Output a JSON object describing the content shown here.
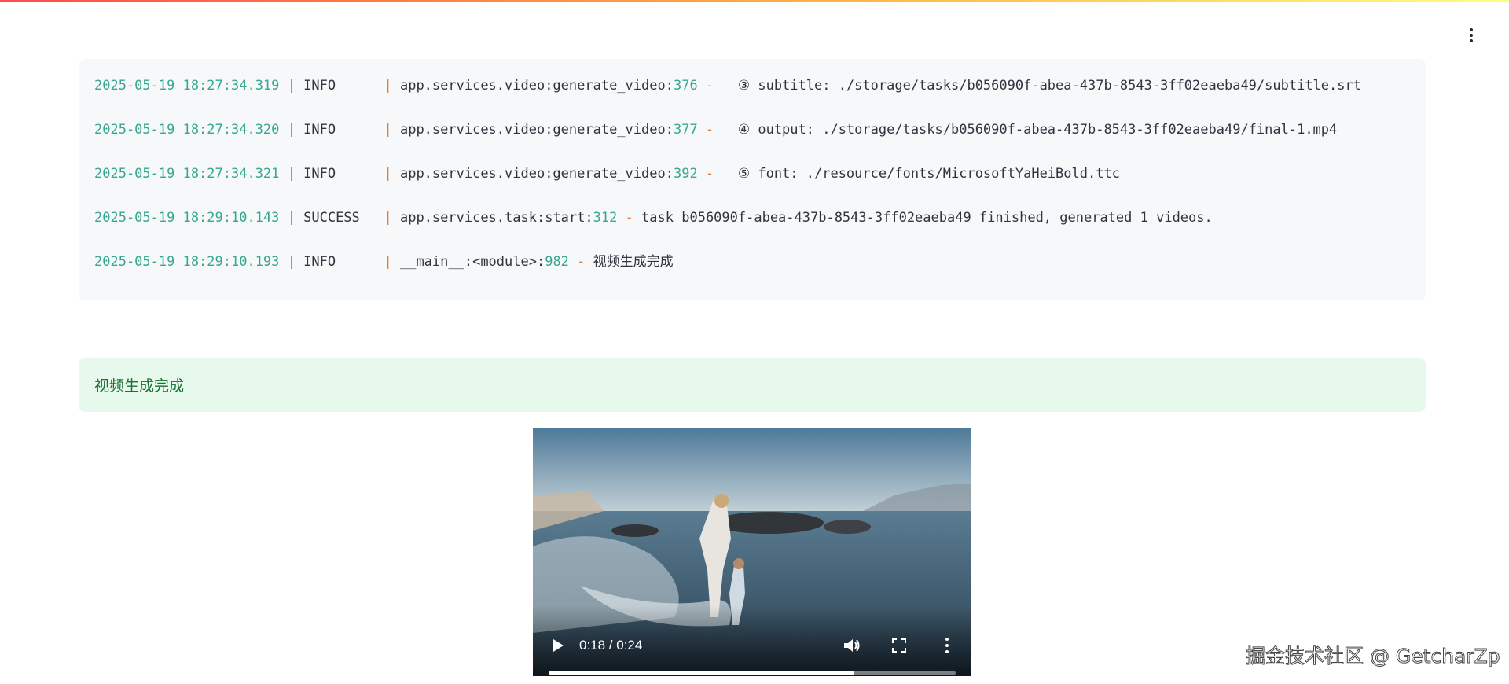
{
  "log": {
    "lines": [
      {
        "ts": "2025-05-19 18:27:34.319",
        "level": "INFO     ",
        "module": "app.services.video:generate_video:",
        "lineno": "376",
        "message": "  ③ subtitle: ./storage/tasks/b056090f-abea-437b-8543-3ff02eaeba49/subtitle.srt"
      },
      {
        "ts": "2025-05-19 18:27:34.320",
        "level": "INFO     ",
        "module": "app.services.video:generate_video:",
        "lineno": "377",
        "message": "  ④ output: ./storage/tasks/b056090f-abea-437b-8543-3ff02eaeba49/final-1.mp4"
      },
      {
        "ts": "2025-05-19 18:27:34.321",
        "level": "INFO     ",
        "module": "app.services.video:generate_video:",
        "lineno": "392",
        "message": "  ⑤ font: ./resource/fonts/MicrosoftYaHeiBold.ttc"
      },
      {
        "ts": "2025-05-19 18:29:10.143",
        "level": "SUCCESS  ",
        "module": "app.services.task:start:",
        "lineno": "312",
        "message": "task b056090f-abea-437b-8543-3ff02eaeba49 finished, generated 1 videos."
      },
      {
        "ts": "2025-05-19 18:29:10.193",
        "level": "INFO     ",
        "module": "__main__:<module>:",
        "lineno": "982",
        "message": "视频生成完成"
      }
    ]
  },
  "success": {
    "message": "视频生成完成"
  },
  "video": {
    "time_display": "0:18 / 0:24",
    "progress_fraction": 0.75
  },
  "watermark": "掘金技术社区 @ GetcharZp",
  "colors": {
    "accent_gradient": [
      "#ff4b4b",
      "#ffbd45",
      "#fffd80"
    ],
    "success_bg": "#e7f8ec",
    "success_text": "#177233",
    "log_timestamp": "#36a891",
    "log_separator": "#e0803c"
  },
  "icons": {
    "menu": "kebab-menu-icon",
    "play": "play-icon",
    "volume": "volume-icon",
    "fullscreen": "fullscreen-icon",
    "more": "more-options-icon"
  }
}
